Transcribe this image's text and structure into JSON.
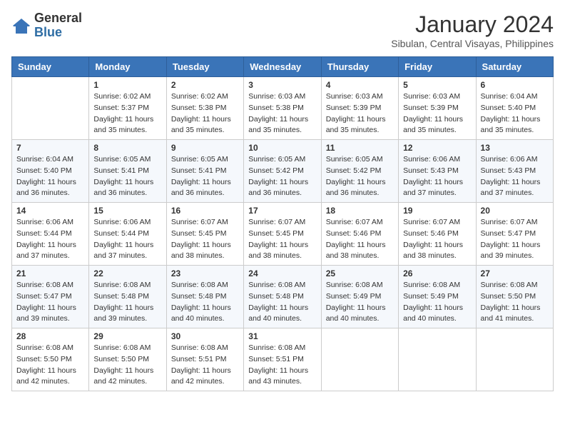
{
  "header": {
    "logo_general": "General",
    "logo_blue": "Blue",
    "month_title": "January 2024",
    "location": "Sibulan, Central Visayas, Philippines"
  },
  "weekdays": [
    "Sunday",
    "Monday",
    "Tuesday",
    "Wednesday",
    "Thursday",
    "Friday",
    "Saturday"
  ],
  "weeks": [
    [
      {
        "day": "",
        "info": ""
      },
      {
        "day": "1",
        "info": "Sunrise: 6:02 AM\nSunset: 5:37 PM\nDaylight: 11 hours\nand 35 minutes."
      },
      {
        "day": "2",
        "info": "Sunrise: 6:02 AM\nSunset: 5:38 PM\nDaylight: 11 hours\nand 35 minutes."
      },
      {
        "day": "3",
        "info": "Sunrise: 6:03 AM\nSunset: 5:38 PM\nDaylight: 11 hours\nand 35 minutes."
      },
      {
        "day": "4",
        "info": "Sunrise: 6:03 AM\nSunset: 5:39 PM\nDaylight: 11 hours\nand 35 minutes."
      },
      {
        "day": "5",
        "info": "Sunrise: 6:03 AM\nSunset: 5:39 PM\nDaylight: 11 hours\nand 35 minutes."
      },
      {
        "day": "6",
        "info": "Sunrise: 6:04 AM\nSunset: 5:40 PM\nDaylight: 11 hours\nand 35 minutes."
      }
    ],
    [
      {
        "day": "7",
        "info": "Sunrise: 6:04 AM\nSunset: 5:40 PM\nDaylight: 11 hours\nand 36 minutes."
      },
      {
        "day": "8",
        "info": "Sunrise: 6:05 AM\nSunset: 5:41 PM\nDaylight: 11 hours\nand 36 minutes."
      },
      {
        "day": "9",
        "info": "Sunrise: 6:05 AM\nSunset: 5:41 PM\nDaylight: 11 hours\nand 36 minutes."
      },
      {
        "day": "10",
        "info": "Sunrise: 6:05 AM\nSunset: 5:42 PM\nDaylight: 11 hours\nand 36 minutes."
      },
      {
        "day": "11",
        "info": "Sunrise: 6:05 AM\nSunset: 5:42 PM\nDaylight: 11 hours\nand 36 minutes."
      },
      {
        "day": "12",
        "info": "Sunrise: 6:06 AM\nSunset: 5:43 PM\nDaylight: 11 hours\nand 37 minutes."
      },
      {
        "day": "13",
        "info": "Sunrise: 6:06 AM\nSunset: 5:43 PM\nDaylight: 11 hours\nand 37 minutes."
      }
    ],
    [
      {
        "day": "14",
        "info": "Sunrise: 6:06 AM\nSunset: 5:44 PM\nDaylight: 11 hours\nand 37 minutes."
      },
      {
        "day": "15",
        "info": "Sunrise: 6:06 AM\nSunset: 5:44 PM\nDaylight: 11 hours\nand 37 minutes."
      },
      {
        "day": "16",
        "info": "Sunrise: 6:07 AM\nSunset: 5:45 PM\nDaylight: 11 hours\nand 38 minutes."
      },
      {
        "day": "17",
        "info": "Sunrise: 6:07 AM\nSunset: 5:45 PM\nDaylight: 11 hours\nand 38 minutes."
      },
      {
        "day": "18",
        "info": "Sunrise: 6:07 AM\nSunset: 5:46 PM\nDaylight: 11 hours\nand 38 minutes."
      },
      {
        "day": "19",
        "info": "Sunrise: 6:07 AM\nSunset: 5:46 PM\nDaylight: 11 hours\nand 38 minutes."
      },
      {
        "day": "20",
        "info": "Sunrise: 6:07 AM\nSunset: 5:47 PM\nDaylight: 11 hours\nand 39 minutes."
      }
    ],
    [
      {
        "day": "21",
        "info": "Sunrise: 6:08 AM\nSunset: 5:47 PM\nDaylight: 11 hours\nand 39 minutes."
      },
      {
        "day": "22",
        "info": "Sunrise: 6:08 AM\nSunset: 5:48 PM\nDaylight: 11 hours\nand 39 minutes."
      },
      {
        "day": "23",
        "info": "Sunrise: 6:08 AM\nSunset: 5:48 PM\nDaylight: 11 hours\nand 40 minutes."
      },
      {
        "day": "24",
        "info": "Sunrise: 6:08 AM\nSunset: 5:48 PM\nDaylight: 11 hours\nand 40 minutes."
      },
      {
        "day": "25",
        "info": "Sunrise: 6:08 AM\nSunset: 5:49 PM\nDaylight: 11 hours\nand 40 minutes."
      },
      {
        "day": "26",
        "info": "Sunrise: 6:08 AM\nSunset: 5:49 PM\nDaylight: 11 hours\nand 40 minutes."
      },
      {
        "day": "27",
        "info": "Sunrise: 6:08 AM\nSunset: 5:50 PM\nDaylight: 11 hours\nand 41 minutes."
      }
    ],
    [
      {
        "day": "28",
        "info": "Sunrise: 6:08 AM\nSunset: 5:50 PM\nDaylight: 11 hours\nand 42 minutes."
      },
      {
        "day": "29",
        "info": "Sunrise: 6:08 AM\nSunset: 5:50 PM\nDaylight: 11 hours\nand 42 minutes."
      },
      {
        "day": "30",
        "info": "Sunrise: 6:08 AM\nSunset: 5:51 PM\nDaylight: 11 hours\nand 42 minutes."
      },
      {
        "day": "31",
        "info": "Sunrise: 6:08 AM\nSunset: 5:51 PM\nDaylight: 11 hours\nand 43 minutes."
      },
      {
        "day": "",
        "info": ""
      },
      {
        "day": "",
        "info": ""
      },
      {
        "day": "",
        "info": ""
      }
    ]
  ]
}
